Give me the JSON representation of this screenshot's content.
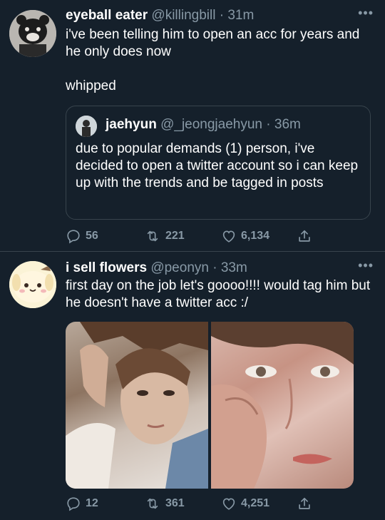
{
  "tweets": [
    {
      "name": "eyeball eater",
      "handle": "@killingbill",
      "sep": "·",
      "time": "31m",
      "text": "i've been telling him to open an acc for years and he only does now\n\nwhipped",
      "quote": {
        "name": "jaehyun",
        "handle": "@_jeongjaehyun",
        "sep": "·",
        "time": "36m",
        "text": "due to popular demands (1) person, i've decided to open a twitter account so i can keep up with the trends and be tagged in posts"
      },
      "replies": "56",
      "retweets": "221",
      "likes": "6,134"
    },
    {
      "name": "i sell flowers",
      "handle": "@peonyn",
      "sep": "·",
      "time": "33m",
      "text": "first day on the job let's goooo!!!! would tag him but he doesn't have a twitter acc :/",
      "replies": "12",
      "retweets": "361",
      "likes": "4,251"
    }
  ],
  "more_label": "•••",
  "icons": {
    "reply": "reply-icon",
    "retweet": "retweet-icon",
    "like": "heart-icon",
    "share": "share-icon",
    "more": "more-icon"
  },
  "colors": {
    "background": "#15202b",
    "muted": "#8899a6",
    "border": "#38444d"
  }
}
